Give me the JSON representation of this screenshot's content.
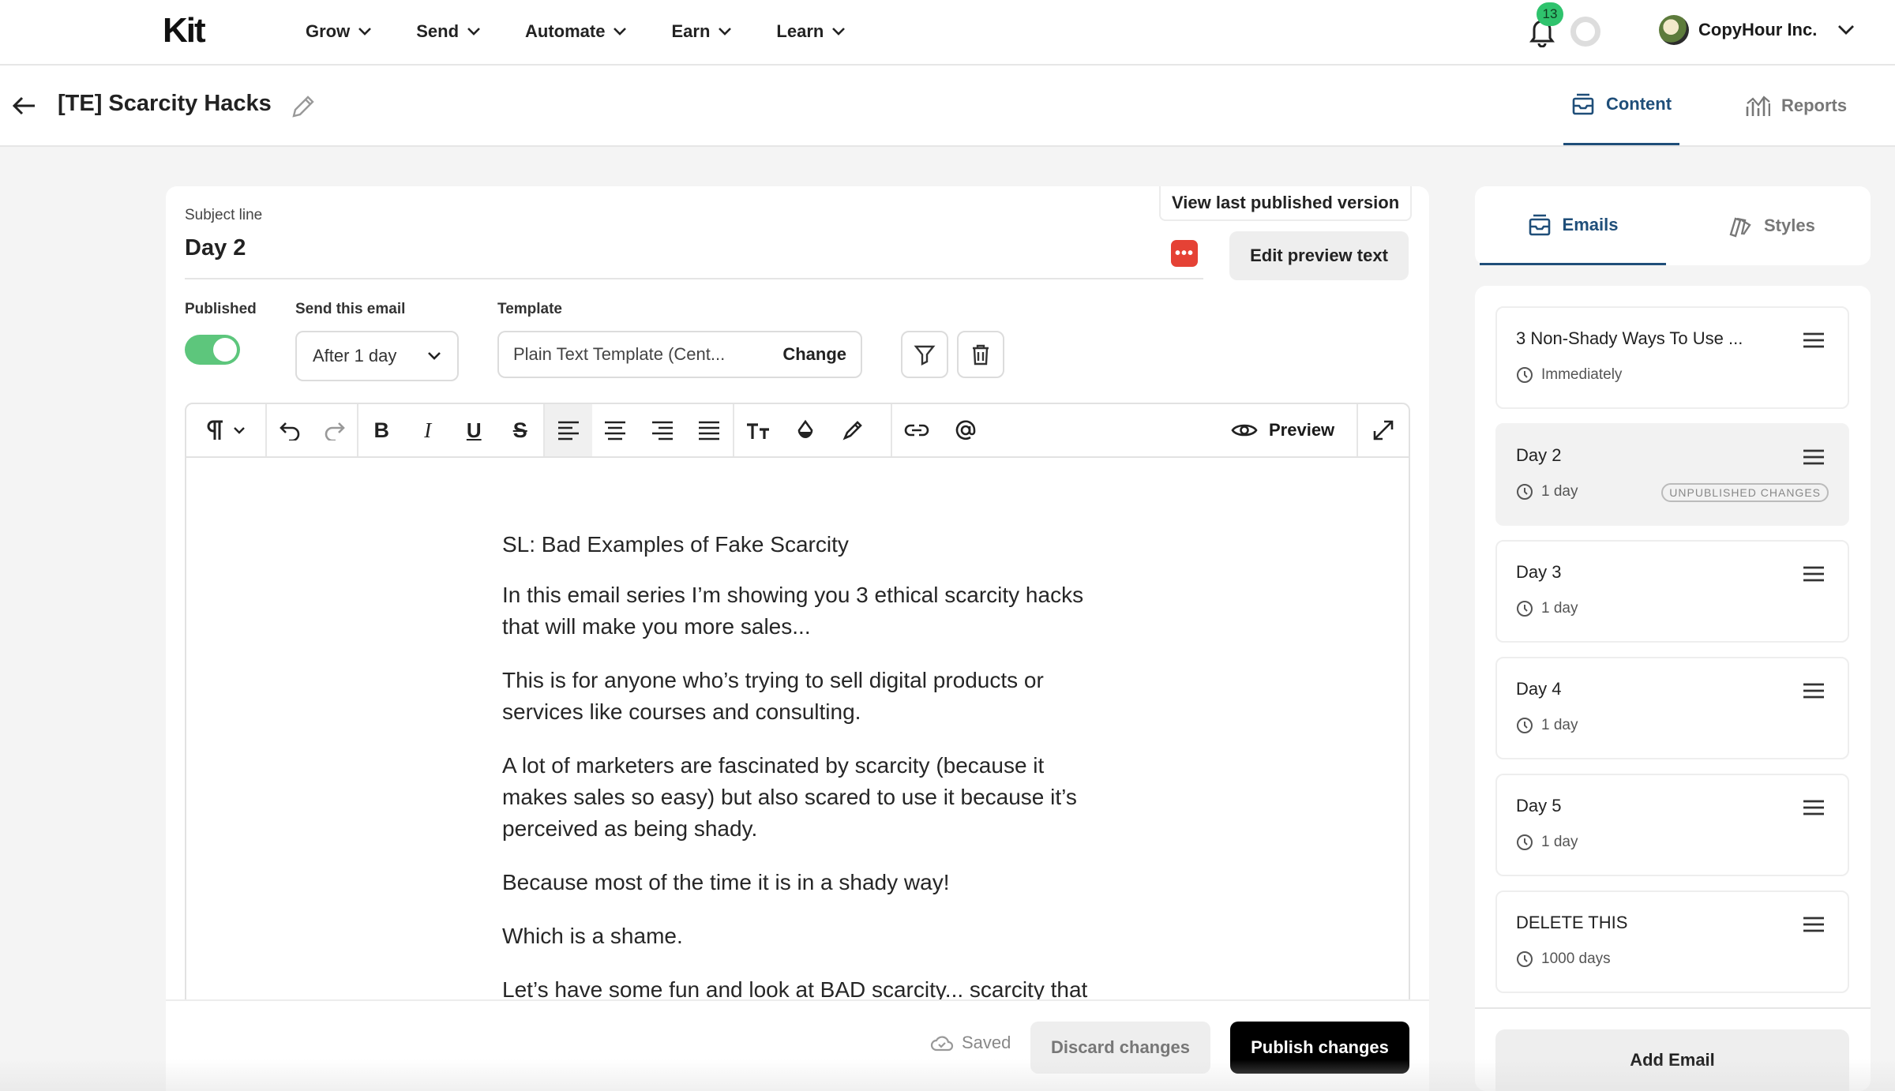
{
  "nav": {
    "logo": "Kit",
    "menu": [
      "Grow",
      "Send",
      "Automate",
      "Earn",
      "Learn"
    ],
    "notifications": "13",
    "account": "CopyHour Inc."
  },
  "header": {
    "title": "[TE] Scarcity Hacks",
    "tabs": {
      "content": "Content",
      "reports": "Reports"
    }
  },
  "editor": {
    "subject_label": "Subject line",
    "subject_value": "Day 2",
    "view_published": "View last published version",
    "edit_preview": "Edit preview text",
    "published_label": "Published",
    "published": true,
    "send_label": "Send this email",
    "send_value": "After 1 day",
    "template_label": "Template",
    "template_value": "Plain Text Template (Cent...",
    "template_change": "Change",
    "preview": "Preview",
    "body": [
      "SL: Bad Examples of Fake Scarcity",
      "In this email series I’m showing you 3 ethical scarcity hacks that will make you more sales...",
      "This is for anyone who’s trying to sell digital products or services like courses and consulting.",
      "A lot of marketers are fascinated by scarcity (because it makes sales so easy) but also scared to use it because it’s perceived as being shady.",
      "Because most of the time it is in a shady way!",
      "Which is a shame.",
      "Let’s have some fun and look at BAD scarcity... scarcity that"
    ],
    "saved": "Saved",
    "discard": "Discard changes",
    "publish": "Publish changes"
  },
  "sidebar": {
    "tabs": {
      "emails": "Emails",
      "styles": "Styles"
    },
    "emails": [
      {
        "title": "3 Non-Shady Ways To Use ...",
        "delay": "Immediately",
        "chip": ""
      },
      {
        "title": "Day 2",
        "delay": "1 day",
        "chip": "UNPUBLISHED CHANGES"
      },
      {
        "title": "Day 3",
        "delay": "1 day",
        "chip": ""
      },
      {
        "title": "Day 4",
        "delay": "1 day",
        "chip": ""
      },
      {
        "title": "Day 5",
        "delay": "1 day",
        "chip": ""
      },
      {
        "title": "DELETE THIS",
        "delay": "1000 days",
        "chip": ""
      }
    ],
    "add_email": "Add Email"
  },
  "colors": {
    "accent": "#1f4e79",
    "toggle": "#5dc67c",
    "badge": "#2fc36d",
    "alert": "#e54235"
  }
}
